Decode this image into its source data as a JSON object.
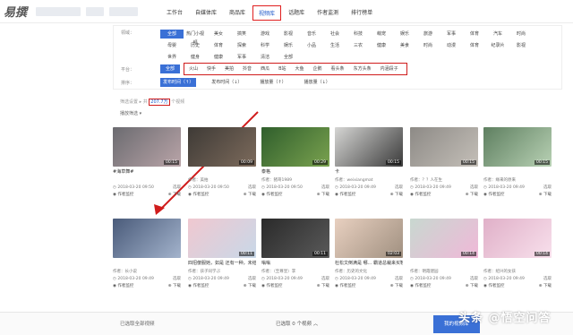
{
  "header": {
    "logo": "易撰",
    "nav": [
      "工作台",
      "自媒体库",
      "商品库",
      "视频库",
      "话题库",
      "作者监测",
      "排行榜单"
    ],
    "active_nav": 3
  },
  "filters": {
    "category_label": "领域：",
    "categories": [
      "全部",
      "热门小视频",
      "美女",
      "搞笑",
      "游戏",
      "影视",
      "音乐",
      "社会",
      "科技",
      "萌宠",
      "娱乐",
      "旅游",
      "军事",
      "体育",
      "汽车",
      "时尚",
      "母婴",
      "历史",
      "体育",
      "探索",
      "科学",
      "娱乐",
      "小品",
      "生活",
      "三农",
      "健康",
      "美食",
      "时尚",
      "动漫",
      "体育",
      "纪录片",
      "影视",
      "世界",
      "健身",
      "健康",
      "军事",
      "清洁",
      "全部"
    ],
    "platform_label": "平台：",
    "platform_all": "全部",
    "platforms": [
      "火山",
      "快手",
      "美拍",
      "抖音",
      "西瓜",
      "B站",
      "大鱼",
      "企鹅",
      "看头条",
      "东方头条",
      "内涵段子"
    ],
    "sort_label": "排序：",
    "sorts": [
      "发布时间（↑）",
      "发布时间（↓）",
      "播放量（↑）",
      "播放量（↓）"
    ]
  },
  "info": {
    "prefix": "筛选设置 ▸ 共",
    "count": "207.7万",
    "suffix": "个视频",
    "action": "播放筛选 ▾"
  },
  "cards": [
    {
      "title": "#海草舞#",
      "author": "",
      "date": "2018-03-20 09:50",
      "duration": "00:15",
      "bg": [
        "#6b6b70",
        "#b9a4a8"
      ]
    },
    {
      "title": "",
      "author": "作者：美拍",
      "date": "2018-03-20 09:50",
      "duration": "00:09",
      "bg": [
        "#3e3a36",
        "#7d6b5c"
      ]
    },
    {
      "title": "泰格",
      "author": "作者：猪哥1989",
      "date": "2018-03-20 09:50",
      "duration": "00:29",
      "bg": [
        "#2f5e2c",
        "#7aa24f"
      ]
    },
    {
      "title": "卡",
      "author": "作者：weixiangmat",
      "date": "2018-03-20 09:49",
      "duration": "00:15",
      "bg": [
        "#d6d6d4",
        "#3a3a3a"
      ]
    },
    {
      "title": "",
      "author": "作者：？？人在生",
      "date": "2018-03-20 09:49",
      "duration": "00:15",
      "bg": [
        "#8d8a86",
        "#c4bfb8"
      ]
    },
    {
      "title": "",
      "author": "作者：缘来的原来",
      "date": "2018-03-20 09:49",
      "duration": "00:15",
      "bg": [
        "#5e7f60",
        "#b8d1b4"
      ]
    },
    {
      "title": "",
      "author": "作者：长小说",
      "date": "2018-03-20 09:49",
      "duration": "",
      "bg": [
        "#4a5b7a",
        "#a3b3cc"
      ]
    },
    {
      "title": "四招傻服她，如是 还有一种，未结",
      "author": "作者：孩子同学ぷ",
      "date": "2018-03-20 09:49",
      "duration": "00:11",
      "bg": [
        "#f0c8d0",
        "#c8d8e8"
      ]
    },
    {
      "title": "嗡嗡",
      "author": "作者：（至尊皇）李",
      "date": "2018-03-20 09:49",
      "duration": "00:11",
      "bg": [
        "#2a2a2a",
        "#5a5a5a"
      ]
    },
    {
      "title": "杜松文倒满是 哪... 霸道总裁来买鞋仔呼...",
      "author": "作者：历史的文化",
      "date": "2018-03-20 09:49",
      "duration": "02:03",
      "bg": [
        "#e8d0c0",
        "#a09080"
      ]
    },
    {
      "title": "",
      "author": "作者：明霞建园",
      "date": "2018-03-20 09:49",
      "duration": "00:14",
      "bg": [
        "#c8d8d0",
        "#f0b8d8"
      ]
    },
    {
      "title": "",
      "author": "作者：绍兴的女孩",
      "date": "2018-03-20 09:49",
      "duration": "00:14",
      "bg": [
        "#e0b0c8",
        "#f8e0ec"
      ]
    }
  ],
  "card_actions": {
    "monitor": "作者监控",
    "download": "下载",
    "pick": "选取"
  },
  "bottom": {
    "left": "已选取全部视频",
    "middle": "已选取 0 个视频 ︿",
    "button": "我的视频库"
  },
  "watermark": "头条 @悟空问答",
  "colors": {
    "accent": "#3a70d6",
    "highlight_border": "#d01c1c"
  }
}
